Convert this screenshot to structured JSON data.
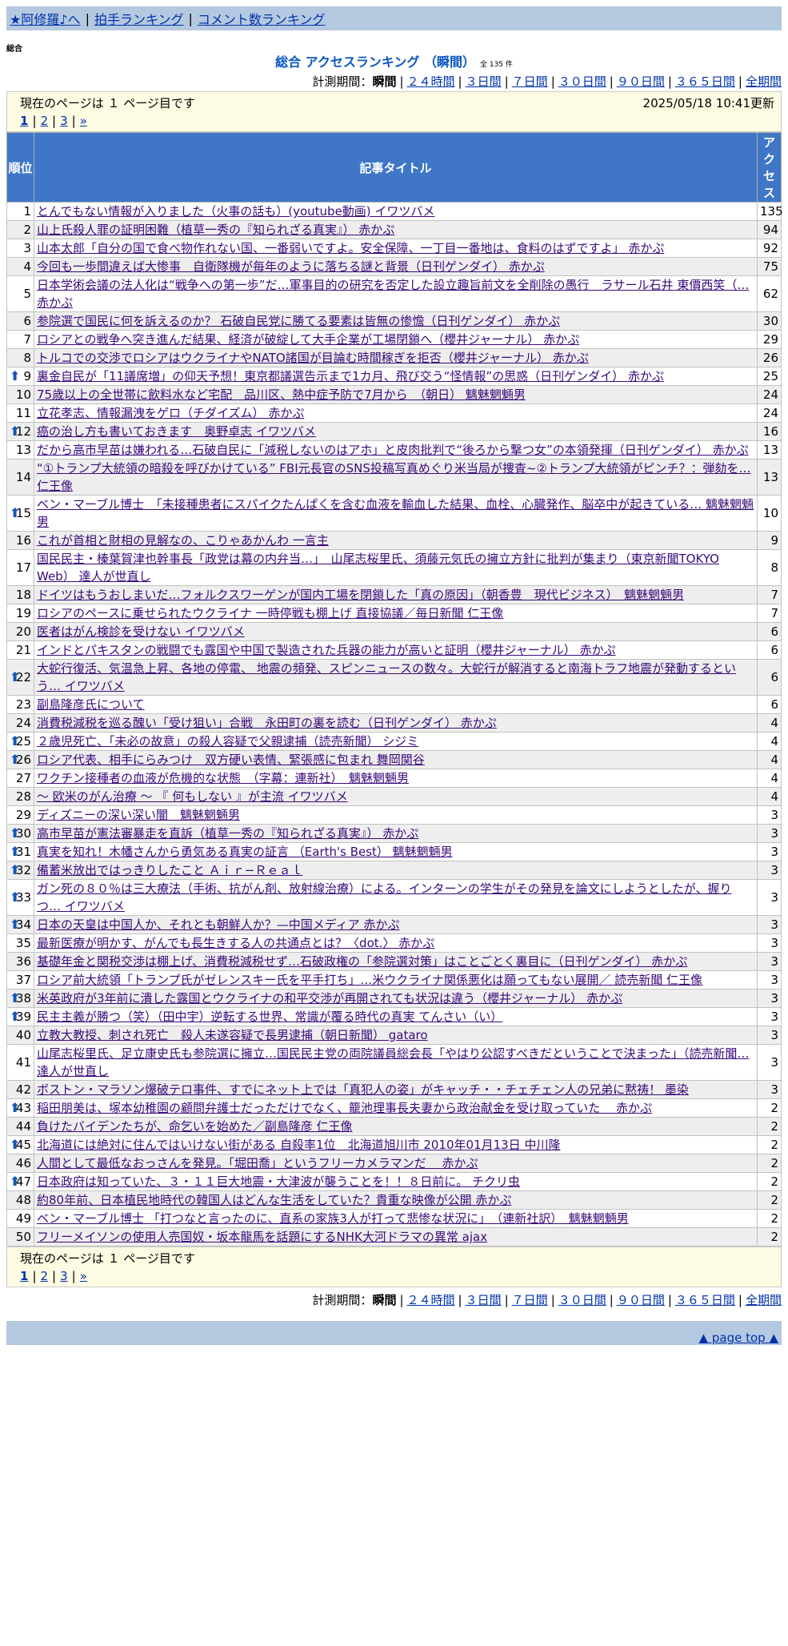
{
  "nav": {
    "home": "★阿修羅♪へ",
    "clap": "拍手ランキング",
    "comment": "コメント数ランキング"
  },
  "section_label": "総合",
  "heading": {
    "title": "総合 アクセスランキング （瞬間）",
    "count": "全 135 件"
  },
  "period": {
    "label": "計測期間：",
    "options": [
      "瞬間",
      "２４時間",
      "３日間",
      "７日間",
      "３０日間",
      "９０日間",
      "３６５日間",
      "全期間"
    ]
  },
  "page_info": {
    "text": "現在のページは １ ページ目です",
    "updated": "2025/05/18 10:41更新"
  },
  "pager": {
    "pages": [
      "1",
      "2",
      "3"
    ],
    "next": "»"
  },
  "table": {
    "headers": {
      "rank": "順位",
      "title": "記事タイトル",
      "access": "アクセス"
    },
    "rows": [
      {
        "rank": "1",
        "up": false,
        "title": "とんでもない情報が入りました（火事の話も）(youtube動画) イワツバメ",
        "count": "135"
      },
      {
        "rank": "2",
        "up": false,
        "title": "山上氏殺人罪の証明困難（植草一秀の『知られざる真実』） 赤かぷ",
        "count": "94"
      },
      {
        "rank": "3",
        "up": false,
        "title": "山本太郎「自分の国で食べ物作れない国、一番弱いですよ。安全保障、一丁目一番地は、食料のはずですよ」 赤かぷ",
        "count": "92"
      },
      {
        "rank": "4",
        "up": false,
        "title": "今回も一歩間違えば大惨事　自衛隊機が毎年のように落ちる謎と背景（日刊ゲンダイ） 赤かぷ",
        "count": "75"
      },
      {
        "rank": "5",
        "up": false,
        "title": "日本学術会議の法人化は“戦争への第一歩”だ…軍事目的の研究を否定した設立趣旨前文を全削除の愚行　ラサール石井 東價西笑（… 赤かぷ",
        "count": "62"
      },
      {
        "rank": "6",
        "up": false,
        "title": "参院選で国民に何を訴えるのか？ 石破自民党に勝てる要素は皆無の惨憺（日刊ゲンダイ） 赤かぷ",
        "count": "30"
      },
      {
        "rank": "7",
        "up": false,
        "title": "ロシアとの戦争へ突き進んだ結果、経済が破綻して大手企業が工場閉鎖へ（櫻井ジャーナル） 赤かぷ",
        "count": "29"
      },
      {
        "rank": "8",
        "up": false,
        "title": "トルコでの交渉でロシアはウクライナやNATO諸国が目論む時間稼ぎを拒否（櫻井ジャーナル） 赤かぷ",
        "count": "26"
      },
      {
        "rank": "9",
        "up": true,
        "title": "裏金自民が「11議席増」の仰天予想！東京都議選告示まで1カ月、飛び交う“怪情報”の思惑（日刊ゲンダイ） 赤かぷ",
        "count": "25"
      },
      {
        "rank": "10",
        "up": false,
        "title": "75歳以上の全世帯に飲料水など宅配　品川区、熱中症予防で7月から　（朝日） 魑魅魍魎男",
        "count": "24"
      },
      {
        "rank": "11",
        "up": false,
        "title": "立花孝志、情報漏洩をゲロ（チダイズム） 赤かぷ",
        "count": "24"
      },
      {
        "rank": "12",
        "up": true,
        "title": "癌の治し方も書いておきます　奥野卓志 イワツバメ",
        "count": "16"
      },
      {
        "rank": "13",
        "up": false,
        "title": "だから高市早苗は嫌われる…石破自民に「減税しないのはアホ」と皮肉批判で“後ろから撃つ女”の本領発揮（日刊ゲンダイ） 赤かぷ",
        "count": "13"
      },
      {
        "rank": "14",
        "up": false,
        "title": "“①トランプ大統領の暗殺を呼びかけている” FBI元長官のSNS投稿写真めぐり米当局が捜査~②トランプ大統領がピンチ？：弾劾を… 仁王像",
        "count": "13"
      },
      {
        "rank": "15",
        "up": true,
        "title": "ベン・マーブル博士　「未接種患者にスパイクたんぱくを含む血液を輸血した結果、血栓、心臓発作、脳卒中が起きている… 魑魅魍魎男",
        "count": "10"
      },
      {
        "rank": "16",
        "up": false,
        "title": "これが首相と財相の見解なの、こりゃあかんわ 一言主",
        "count": "9"
      },
      {
        "rank": "17",
        "up": false,
        "title": "国民民主・榛葉賀津也幹事長「政党は幕の内弁当…」　山尾志桜里氏、須藤元気氏の擁立方針に批判が集まり（東京新聞TOKYO Web） 達人が世直し",
        "count": "8"
      },
      {
        "rank": "18",
        "up": false,
        "title": "ドイツはもうおしまいだ…フォルクスワーゲンが国内工場を閉鎖した「真の原因」（朝香豊　現代ビジネス）　魑魅魍魎男",
        "count": "7"
      },
      {
        "rank": "19",
        "up": false,
        "title": "ロシアのペースに乗せられたウクライナ 一時停戦も棚上げ 直接協議／毎日新聞 仁王像",
        "count": "7"
      },
      {
        "rank": "20",
        "up": false,
        "title": "医者はがん検診を受けない イワツバメ",
        "count": "6"
      },
      {
        "rank": "21",
        "up": false,
        "title": "インドとパキスタンの戦闘でも露国や中国で製造された兵器の能力が高いと証明（櫻井ジャーナル） 赤かぷ",
        "count": "6"
      },
      {
        "rank": "22",
        "up": true,
        "title": "大蛇行復活、気温急上昇、各地の停電、 地震の頻発、スピンニュースの数々。大蛇行が解消すると南海トラフ地震が発動するという… イワツバメ",
        "count": "6"
      },
      {
        "rank": "23",
        "up": false,
        "title": "副島隆彦氏について",
        "count": "6"
      },
      {
        "rank": "24",
        "up": false,
        "title": "消費税減税を巡る醜い「受け狙い」合戦　永田町の裏を読む（日刊ゲンダイ） 赤かぷ",
        "count": "4"
      },
      {
        "rank": "25",
        "up": true,
        "title": "２歳児死亡、「未必の故意」の殺人容疑で父親逮捕（読売新聞） シジミ",
        "count": "4"
      },
      {
        "rank": "26",
        "up": true,
        "title": "ロシア代表、相手にらみつけ　双方硬い表情、緊張感に包まれ 舞岡関谷",
        "count": "4"
      },
      {
        "rank": "27",
        "up": false,
        "title": "ワクチン接種者の血液が危機的な状態　（字幕：連新社）　魑魅魍魎男",
        "count": "4"
      },
      {
        "rank": "28",
        "up": false,
        "title": "～ 欧米のがん治療 ～ 『 何もしない 』が主流 イワツバメ",
        "count": "4"
      },
      {
        "rank": "29",
        "up": false,
        "title": "ディズニーの深い深い闇　魑魅魍魎男",
        "count": "3"
      },
      {
        "rank": "30",
        "up": true,
        "title": "高市早苗が憲法審暴走を直訴（植草一秀の『知られざる真実』） 赤かぷ",
        "count": "3"
      },
      {
        "rank": "31",
        "up": true,
        "title": "真実を知れ！木幡さんから勇気ある真実の証言 （Earth's Best） 魑魅魍魎男",
        "count": "3"
      },
      {
        "rank": "32",
        "up": true,
        "title": "備蓄米放出ではっきりしたこと Ａｉｒ−Ｒｅａｌ",
        "count": "3"
      },
      {
        "rank": "33",
        "up": true,
        "title": "ガン死の８０％は三大療法（手術、抗がん剤、放射線治療）による。インターンの学生がその発見を論文にしようとしたが、握りつ… イワツバメ",
        "count": "3"
      },
      {
        "rank": "34",
        "up": true,
        "title": "日本の天皇は中国人か、それとも朝鮮人か？—中国メディア 赤かぷ",
        "count": "3"
      },
      {
        "rank": "35",
        "up": false,
        "title": "最新医療が明かす、がんでも長生きする人の共通点とは？〈dot.〉 赤かぷ",
        "count": "3"
      },
      {
        "rank": "36",
        "up": false,
        "title": "基礎年金と関税交渉は棚上げ、消費税減税せず…石破政権の「参院選対策」はことごとく裏目に（日刊ゲンダイ） 赤かぷ",
        "count": "3"
      },
      {
        "rank": "37",
        "up": false,
        "title": "ロシア前大統領「トランプ氏がゼレンスキー氏を平手打ち」…米ウクライナ関係悪化は願ってもない展開／ 読売新聞 仁王像",
        "count": "3"
      },
      {
        "rank": "38",
        "up": true,
        "title": "米英政府が3年前に潰した露国とウクライナの和平交渉が再開されても状況は違う（櫻井ジャーナル） 赤かぷ",
        "count": "3"
      },
      {
        "rank": "39",
        "up": true,
        "title": "民主主義が勝つ（笑）（田中宇）逆転する世界、常識が覆る時代の真実 てんさい（い）",
        "count": "3"
      },
      {
        "rank": "40",
        "up": false,
        "title": "立教大教授、刺され死亡　殺人未遂容疑で長男逮捕（朝日新聞） gataro",
        "count": "3"
      },
      {
        "rank": "41",
        "up": false,
        "title": "山尾志桜里氏、足立康史氏も参院選に擁立…国民民主党の両院議員総会長「やはり公認すべきだということで決まった」（読売新聞… 達人が世直し",
        "count": "3"
      },
      {
        "rank": "42",
        "up": false,
        "title": "ボストン・マラソン爆破テロ事件、すでにネット上では「真犯人の姿」がキャッチ・・チェチェン人の兄弟に黙祷！ 墨染",
        "count": "3"
      },
      {
        "rank": "43",
        "up": true,
        "title": "稲田朋美は、塚本幼稚園の顧問弁護士だっただけでなく、籠池理事長夫妻から政治献金を受け取っていた　 赤かぷ",
        "count": "2"
      },
      {
        "rank": "44",
        "up": false,
        "title": "負けたバイデンたちが、命乞いを始めた／副島隆彦 仁王像",
        "count": "2"
      },
      {
        "rank": "45",
        "up": true,
        "title": "北海道には絶対に住んではいけない街がある 自殺率1位　北海道旭川市 2010年01月13日 中川隆",
        "count": "2"
      },
      {
        "rank": "46",
        "up": false,
        "title": "人間として最低なおっさんを発見。「堀田喬」というフリーカメラマンだ　 赤かぷ",
        "count": "2"
      },
      {
        "rank": "47",
        "up": true,
        "title": "日本政府は知っていた、３・１１巨大地震・大津波が襲うことを！！８日前に。 チクリ虫",
        "count": "2"
      },
      {
        "rank": "48",
        "up": false,
        "title": "約80年前、日本植民地時代の韓国人はどんな生活をしていた？貴重な映像が公開 赤かぷ",
        "count": "2"
      },
      {
        "rank": "49",
        "up": false,
        "title": "ベン・マーブル博士 「打つなと言ったのに、直系の家族3人が打って悲惨な状況に」　（連新社訳）　魑魅魍魎男",
        "count": "2"
      },
      {
        "rank": "50",
        "up": false,
        "title": "フリーメイソンの使用人売国奴・坂本龍馬を話題にするNHK大河ドラマの異常 ajax",
        "count": "2"
      }
    ]
  },
  "footer": {
    "page_top": "▲ page top ▲"
  },
  "colors": {
    "header_bg": "#3f77c6",
    "bar_bg": "#b4c8e0",
    "pagebox_bg": "#fdfbe2",
    "up_arrow": "#1456b8"
  },
  "icons": {
    "up": "up-arrow-icon"
  }
}
